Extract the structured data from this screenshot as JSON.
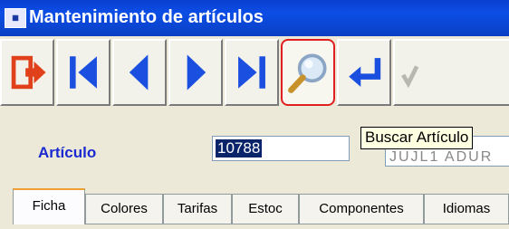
{
  "window": {
    "title": "Mantenimiento de artículos",
    "icon": "app-icon"
  },
  "toolbar": {
    "buttons": [
      {
        "name": "exit-button",
        "icon": "exit-icon",
        "color": "#e0401a"
      },
      {
        "name": "first-record-button",
        "icon": "first-record-icon",
        "color": "#1a4fe0"
      },
      {
        "name": "previous-record-button",
        "icon": "previous-record-icon",
        "color": "#1a4fe0"
      },
      {
        "name": "next-record-button",
        "icon": "next-record-icon",
        "color": "#1a4fe0"
      },
      {
        "name": "last-record-button",
        "icon": "last-record-icon",
        "color": "#1a4fe0"
      },
      {
        "name": "search-button",
        "icon": "magnifier-icon",
        "active": true
      },
      {
        "name": "enter-button",
        "icon": "enter-icon",
        "color": "#1a4fe0"
      },
      {
        "name": "confirm-button",
        "icon": "check-icon",
        "disabled": true
      }
    ]
  },
  "tooltip": {
    "text": "Buscar Artículo"
  },
  "form": {
    "article_label": "Artículo",
    "article_code": "10788",
    "article_description": "JUJL1 ADUR"
  },
  "tabs": [
    {
      "label": "Ficha",
      "selected": true
    },
    {
      "label": "Colores"
    },
    {
      "label": "Tarifas"
    },
    {
      "label": "Estoc"
    },
    {
      "label": "Componentes"
    },
    {
      "label": "Idiomas"
    }
  ],
  "colors": {
    "titlebar": "#0a3fd0",
    "label": "#1a2ad0",
    "selection": "#0a246a",
    "tooltip_bg": "#ffffe1"
  }
}
